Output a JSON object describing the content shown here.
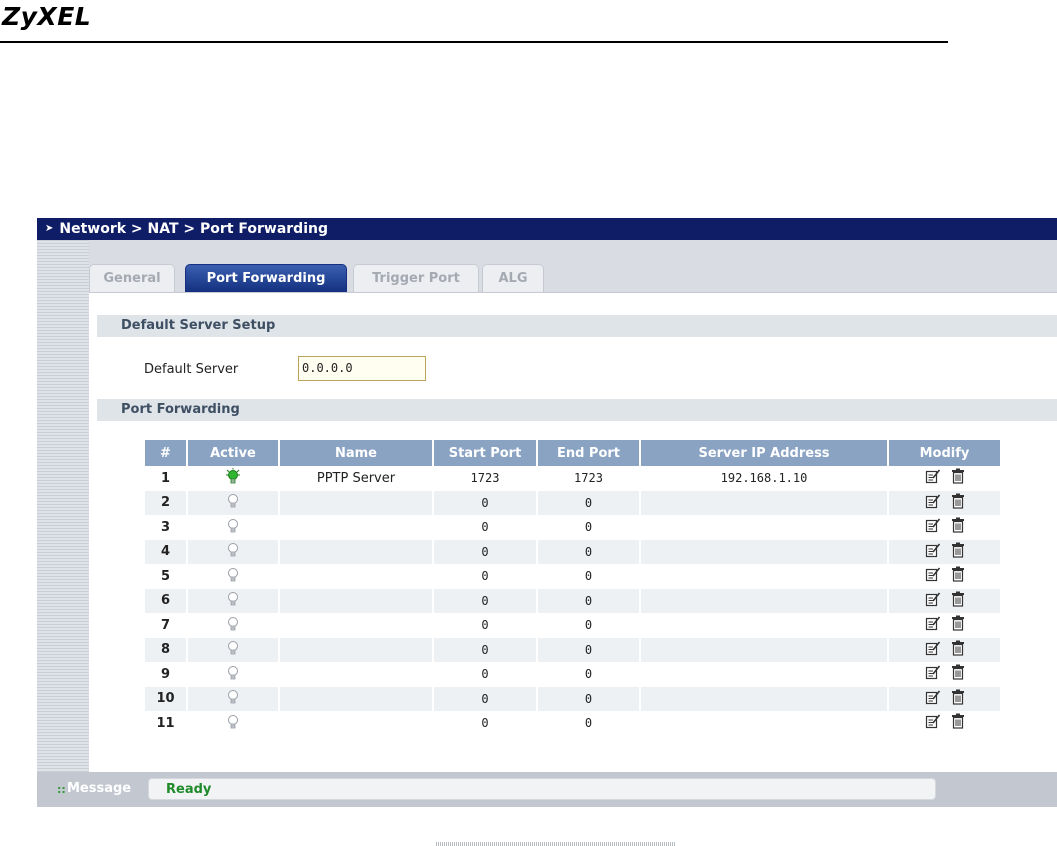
{
  "header": {
    "brand": "ZyXEL"
  },
  "breadcrumb": "Network > NAT > Port Forwarding",
  "tabs": [
    {
      "label": "General",
      "active": false
    },
    {
      "label": "Port Forwarding",
      "active": true
    },
    {
      "label": "Trigger Port",
      "active": false
    },
    {
      "label": "ALG",
      "active": false
    }
  ],
  "default_server_section": {
    "title": "Default Server Setup",
    "field_label": "Default Server",
    "field_value": "0.0.0.0"
  },
  "port_forwarding_section": {
    "title": "Port Forwarding"
  },
  "table": {
    "columns": [
      "#",
      "Active",
      "Name",
      "Start Port",
      "End Port",
      "Server IP Address",
      "Modify"
    ],
    "rows": [
      {
        "num": "1",
        "active": true,
        "name": "PPTP Server",
        "start": "1723",
        "end": "1723",
        "ip": "192.168.1.10"
      },
      {
        "num": "2",
        "active": false,
        "name": "",
        "start": "0",
        "end": "0",
        "ip": ""
      },
      {
        "num": "3",
        "active": false,
        "name": "",
        "start": "0",
        "end": "0",
        "ip": ""
      },
      {
        "num": "4",
        "active": false,
        "name": "",
        "start": "0",
        "end": "0",
        "ip": ""
      },
      {
        "num": "5",
        "active": false,
        "name": "",
        "start": "0",
        "end": "0",
        "ip": ""
      },
      {
        "num": "6",
        "active": false,
        "name": "",
        "start": "0",
        "end": "0",
        "ip": ""
      },
      {
        "num": "7",
        "active": false,
        "name": "",
        "start": "0",
        "end": "0",
        "ip": ""
      },
      {
        "num": "8",
        "active": false,
        "name": "",
        "start": "0",
        "end": "0",
        "ip": ""
      },
      {
        "num": "9",
        "active": false,
        "name": "",
        "start": "0",
        "end": "0",
        "ip": ""
      },
      {
        "num": "10",
        "active": false,
        "name": "",
        "start": "0",
        "end": "0",
        "ip": ""
      },
      {
        "num": "11",
        "active": false,
        "name": "",
        "start": "0",
        "end": "0",
        "ip": ""
      }
    ]
  },
  "icons": {
    "active_bulb": "lightbulb-on-icon",
    "inactive_bulb": "lightbulb-off-icon",
    "edit": "edit-icon",
    "delete": "delete-icon"
  },
  "colors": {
    "titlebar": "#0f1d66",
    "active_bulb": "#2fb52f",
    "status_ok": "#1f8a2a",
    "table_header": "#8aa3c3"
  },
  "status": {
    "label": "Message",
    "text": "Ready"
  }
}
